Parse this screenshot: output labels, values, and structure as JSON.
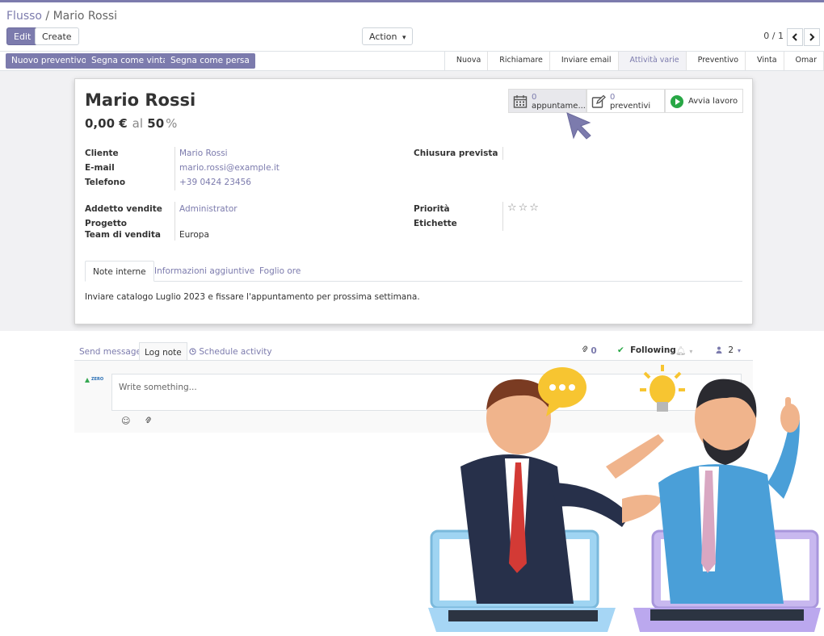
{
  "breadcrumb": {
    "parent": "Flusso",
    "separator": " / ",
    "current": "Mario Rossi"
  },
  "toolbar": {
    "edit": "Edit",
    "create": "Create",
    "action": "Action",
    "action_caret": "▾",
    "pager": "0 / 1",
    "prev": "‹",
    "next": "›"
  },
  "statusbar": {
    "buttons": [
      "Nuovo preventivo",
      "Segna come vinta",
      "Segna come persa"
    ],
    "stages": [
      "Nuova",
      "Richiamare",
      "Inviare email",
      "Attività varie",
      "Preventivo",
      "Vinta",
      "Omar"
    ],
    "active_stage": "Attività varie"
  },
  "record": {
    "name": "Mario Rossi",
    "revenue": "0,00 €",
    "prob_prefix": "al",
    "probability": "50",
    "prob_unit": "%"
  },
  "stat_buttons": {
    "meetings": {
      "count": "0",
      "label": "appuntame..."
    },
    "quotes": {
      "count": "0",
      "label": "preventivi"
    },
    "start": {
      "label": "Avvia lavoro"
    }
  },
  "fields": {
    "customer_label": "Cliente",
    "customer_value": "Mario Rossi",
    "email_label": "E-mail",
    "email_value": "mario.rossi@example.it",
    "phone_label": "Telefono",
    "phone_value": "+39 0424 23456",
    "closing_label": "Chiusura prevista",
    "salesperson_label": "Addetto vendite",
    "salesperson_value": "Administrator",
    "project_label": "Progetto",
    "team_label": "Team di vendita",
    "team_value": "Europa",
    "priority_label": "Priorità",
    "priority_stars": "☆☆☆",
    "tags_label": "Etichette"
  },
  "tabs": [
    "Note interne",
    "Informazioni aggiuntive",
    "Foglio ore"
  ],
  "notes": "Inviare catalogo Luglio 2023 e fissare l'appuntamento per prossima settimana.",
  "chatter": {
    "send_message": "Send message",
    "log_note": "Log note",
    "schedule_activity": "Schedule activity",
    "attachments": "0",
    "following": "Following",
    "followers": "2",
    "placeholder": "Write something...",
    "avatar_text": "ZERO"
  },
  "colors": {
    "accent": "#7c7bad",
    "start_icon": "#28a745"
  }
}
